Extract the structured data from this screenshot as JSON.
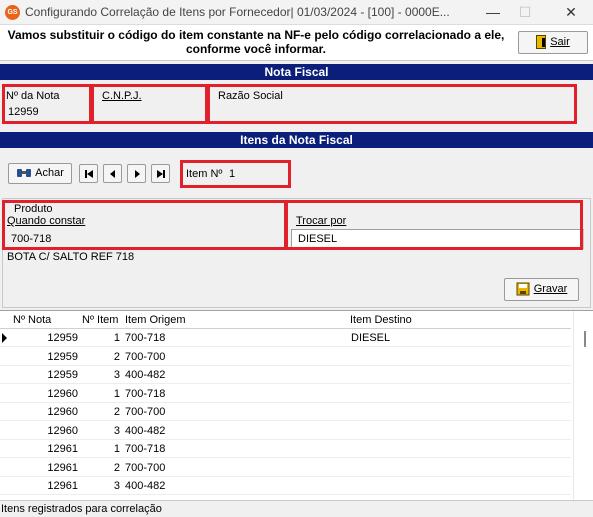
{
  "window": {
    "title": "Configurando Correlação de Itens por Fornecedor| 01/03/2024 - [100] - 0000E...",
    "app_icon_text": "GS",
    "minimize": "—",
    "maximize": "☐",
    "close": "✕"
  },
  "message": {
    "line1": "Vamos substituir o código do item constante na NF-e pelo código correlacionado a ele,",
    "line2": "conforme você informar."
  },
  "sair_button": {
    "label": "Sair",
    "icon": "exit-door-icon"
  },
  "nota_fiscal": {
    "header": "Nota Fiscal",
    "numero_label": "Nº da Nota",
    "numero_value": "12959",
    "cnpj_label": "C.N.P.J.",
    "cnpj_value": "",
    "razao_label": "Razão Social",
    "razao_value": ""
  },
  "itens": {
    "header": "Itens da Nota Fiscal",
    "achar_label": "Achar",
    "achar_icon": "binoculars-icon",
    "item_label": "Item Nº",
    "item_value": "1",
    "produto_group": "Produto",
    "quando_label": "Quando constar",
    "quando_value": "700-718",
    "trocar_label": "Trocar por",
    "trocar_value": "DIESEL",
    "description": "BOTA C/ SALTO REF 718",
    "gravar_label": "Gravar",
    "gravar_icon": "save-icon"
  },
  "grid": {
    "columns": [
      "Nº Nota",
      "Nº Item",
      "Item Origem",
      "Item Destino"
    ],
    "rows": [
      {
        "nota": "12959",
        "item": "1",
        "origem": "700-718",
        "destino": "DIESEL"
      },
      {
        "nota": "12959",
        "item": "2",
        "origem": "700-700",
        "destino": ""
      },
      {
        "nota": "12959",
        "item": "3",
        "origem": "400-482",
        "destino": ""
      },
      {
        "nota": "12960",
        "item": "1",
        "origem": "700-718",
        "destino": ""
      },
      {
        "nota": "12960",
        "item": "2",
        "origem": "700-700",
        "destino": ""
      },
      {
        "nota": "12960",
        "item": "3",
        "origem": "400-482",
        "destino": ""
      },
      {
        "nota": "12961",
        "item": "1",
        "origem": "700-718",
        "destino": ""
      },
      {
        "nota": "12961",
        "item": "2",
        "origem": "700-700",
        "destino": ""
      },
      {
        "nota": "12961",
        "item": "3",
        "origem": "400-482",
        "destino": ""
      }
    ]
  },
  "status": {
    "text": "Itens registrados para correlação"
  },
  "colors": {
    "header_bg": "#0a1e7a",
    "highlight": "#e0202b",
    "app_icon": "#e8641b"
  }
}
